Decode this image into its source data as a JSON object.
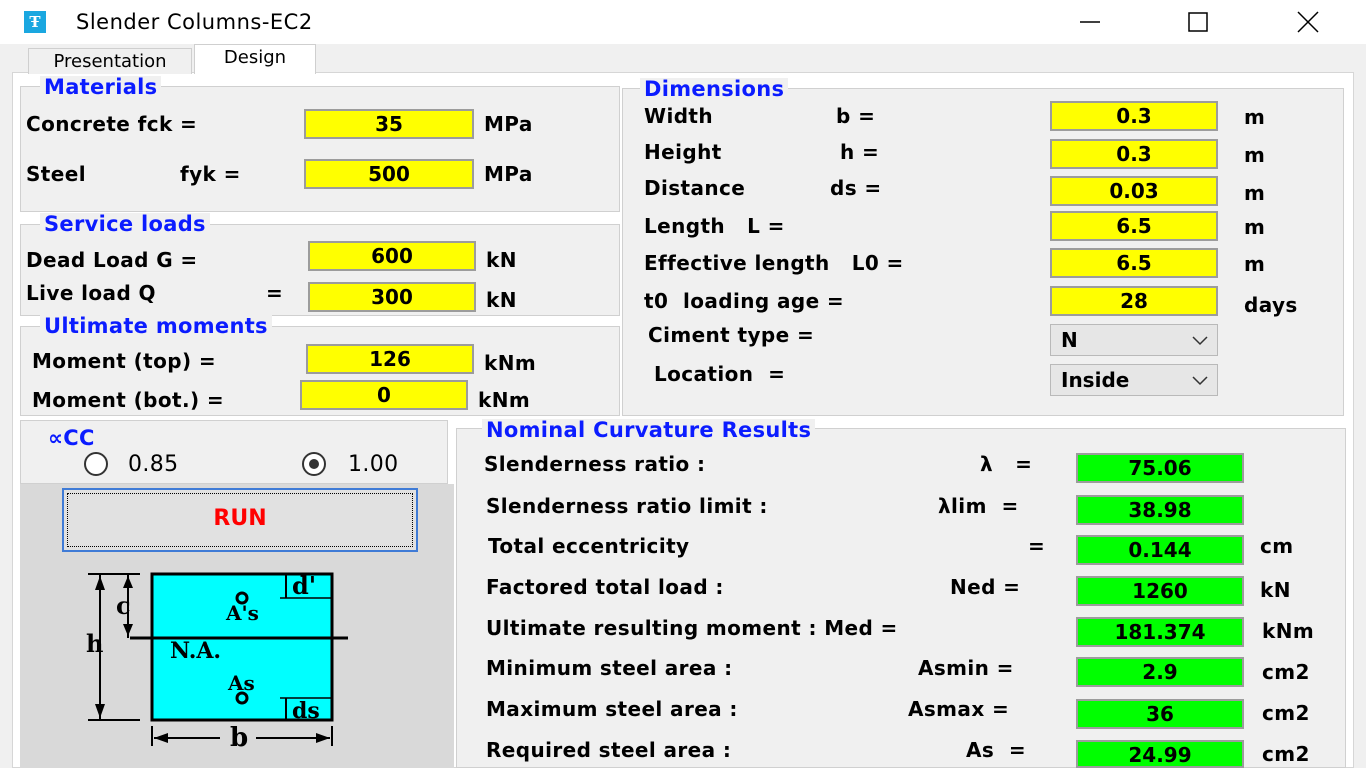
{
  "window": {
    "title": "Slender Columns-EC2",
    "icon": "app-icon"
  },
  "tabs": [
    "Presentation",
    "Design"
  ],
  "materials": {
    "title": "Materials",
    "concrete_label": "Concrete fck =",
    "concrete_value": "35",
    "concrete_unit": "MPa",
    "steel_label": "Steel",
    "steel_sym": "fyk  =",
    "steel_value": "500",
    "steel_unit": "MPa"
  },
  "service_loads": {
    "title": "Service loads",
    "dead_label": "Dead Load G  =",
    "dead_value": "600",
    "dead_unit": "kN",
    "live_label": "Live load Q",
    "live_eq": "=",
    "live_value": "300",
    "live_unit": "kN"
  },
  "ultimate_moments": {
    "title": "Ultimate moments",
    "top_label": "Moment (top)  =",
    "top_value": "126",
    "top_unit": "kNm",
    "bot_label": "Moment (bot.) =",
    "bot_value": "0",
    "bot_unit": "kNm"
  },
  "alpha_cc": {
    "title": "∝CC",
    "option1": "0.85",
    "option2": "1.00",
    "selected": "1.00"
  },
  "run_label": "RUN",
  "diagram": {
    "c": "c",
    "d_prime": "d'",
    "As_prime": "A's",
    "h": "h",
    "na": "N.A.",
    "As": "As",
    "ds": "ds",
    "b": "b"
  },
  "dimensions": {
    "title": "Dimensions",
    "rows": [
      {
        "label": "Width",
        "sym": "b =",
        "value": "0.3",
        "unit": "m"
      },
      {
        "label": "Height",
        "sym": "h =",
        "value": "0.3",
        "unit": "m"
      },
      {
        "label": "Distance",
        "sym": "ds =",
        "value": "0.03",
        "unit": "m"
      },
      {
        "label": "Length   L =",
        "sym": "",
        "value": "6.5",
        "unit": "m"
      },
      {
        "label": "Effective length   L0 =",
        "sym": "",
        "value": "6.5",
        "unit": "m"
      },
      {
        "label": "t0  loading age =",
        "sym": "",
        "value": "28",
        "unit": "days"
      }
    ],
    "ciment_label": "Ciment type =",
    "ciment_value": "N",
    "location_label": "Location  =",
    "location_value": "Inside"
  },
  "results": {
    "title": "Nominal Curvature Results",
    "rows": [
      {
        "label": "Slenderness ratio :",
        "sym": "λ   =",
        "value": "75.06",
        "unit": ""
      },
      {
        "label": "Slenderness ratio limit :",
        "sym": "λlim  =",
        "value": "38.98",
        "unit": ""
      },
      {
        "label": "Total eccentricity",
        "sym": "=",
        "value": "0.144",
        "unit": "cm"
      },
      {
        "label": "Factored total load :",
        "sym": "Ned =",
        "value": "1260",
        "unit": "kN"
      },
      {
        "label": "Ultimate resulting moment : Med =",
        "sym": "",
        "value": "181.374",
        "unit": "kNm"
      },
      {
        "label": "Minimum steel area :",
        "sym": "Asmin =",
        "value": "2.9",
        "unit": "cm2"
      },
      {
        "label": "Maximum steel area :",
        "sym": "Asmax =",
        "value": "36",
        "unit": "cm2"
      },
      {
        "label": "Required steel area :",
        "sym": "As  =",
        "value": "24.99",
        "unit": "cm2"
      }
    ]
  },
  "colors": {
    "input_yellow": "#ffff00",
    "result_green": "#00ff00",
    "title_blue": "#0b1cff",
    "run_red": "#ff0000",
    "section_cyan": "#00ffff"
  }
}
